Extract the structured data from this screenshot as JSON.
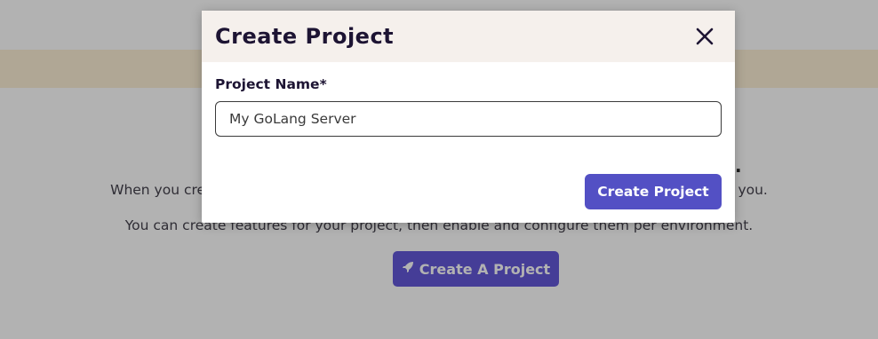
{
  "background": {
    "intro_line": "When you create a project, we also create a development and production environment for you.",
    "features_line": "You can create features for your project, then enable and configure them per environment.",
    "cta_label": "Create A Project",
    "cta_icon": "rocket-icon"
  },
  "modal": {
    "title": "Create Project",
    "close_icon": "close-icon",
    "field_label": "Project Name*",
    "field_value": "My GoLang Server",
    "submit_label": "Create Project"
  },
  "colors": {
    "banner": "#fcefd6",
    "primary_button": "#5350c4",
    "header_bg": "#f5f0ec",
    "title_text": "#1d1433"
  }
}
